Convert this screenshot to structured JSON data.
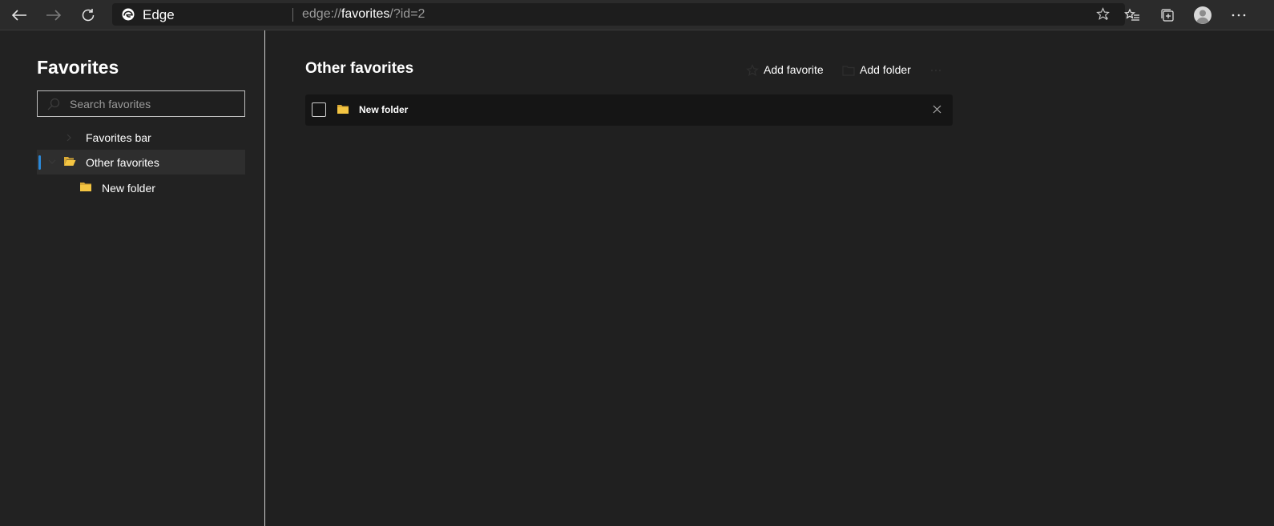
{
  "toolbar": {
    "site_name": "Edge",
    "url_scheme": "edge://",
    "url_host": "favorites",
    "url_path": "/?id=2"
  },
  "sidebar": {
    "title": "Favorites",
    "search_placeholder": "Search favorites",
    "tree": [
      {
        "label": "Favorites bar",
        "selected": false
      },
      {
        "label": "Other favorites",
        "selected": true
      },
      {
        "label": "New folder",
        "selected": false
      }
    ]
  },
  "main": {
    "title": "Other favorites",
    "add_favorite_label": "Add favorite",
    "add_folder_label": "Add folder",
    "items": [
      {
        "label": "New folder",
        "type": "folder"
      }
    ]
  },
  "colors": {
    "background": "#202020",
    "toolbar": "#2b2b2b",
    "accent": "#2b88d8",
    "folder": "#f4c542"
  }
}
